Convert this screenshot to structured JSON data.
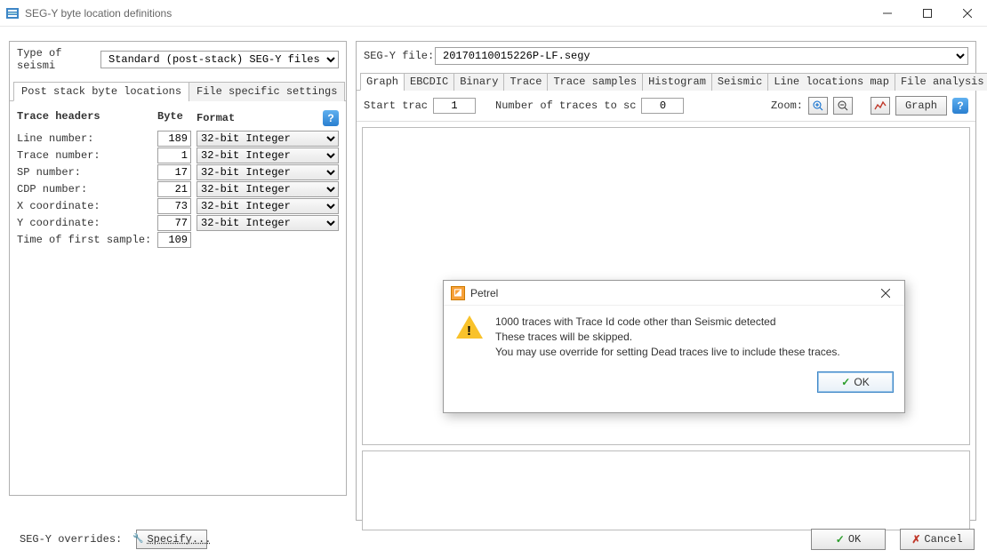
{
  "window": {
    "title": "SEG-Y byte location definitions",
    "min_tip": "Minimize",
    "max_tip": "Maximize",
    "close_tip": "Close"
  },
  "left": {
    "type_label": "Type of seismi",
    "type_value": "Standard (post-stack) SEG-Y files",
    "tabs": {
      "post_stack": "Post stack byte locations",
      "file_specific": "File specific settings"
    },
    "headers": {
      "title": "Trace headers",
      "byte": "Byte",
      "format": "Format",
      "rows": [
        {
          "name": "Line number:",
          "byte": "189",
          "format": "32-bit Integer"
        },
        {
          "name": "Trace  number:",
          "byte": "1",
          "format": "32-bit Integer"
        },
        {
          "name": "SP number:",
          "byte": "17",
          "format": "32-bit Integer"
        },
        {
          "name": "CDP number:",
          "byte": "21",
          "format": "32-bit Integer"
        },
        {
          "name": "X coordinate:",
          "byte": "73",
          "format": "32-bit Integer"
        },
        {
          "name": "Y coordinate:",
          "byte": "77",
          "format": "32-bit Integer"
        },
        {
          "name": "Time of first sample:",
          "byte": "109",
          "format": ""
        }
      ]
    }
  },
  "right": {
    "file_label": "SEG-Y file:",
    "file_value": "20170110015226P-LF.segy",
    "tabs": [
      "Graph",
      "EBCDIC",
      "Binary",
      "Trace",
      "Trace samples",
      "Histogram",
      "Seismic",
      "Line locations map",
      "File analysis"
    ],
    "toolbar": {
      "start_trace": "Start trac",
      "start_trace_val": "1",
      "num_traces": "Number of traces to sc",
      "num_traces_val": "0",
      "zoom": "Zoom:",
      "graph_btn": "Graph"
    }
  },
  "footer": {
    "overrides": "SEG-Y overrides:",
    "specify": "Specify...",
    "ok": "OK",
    "cancel": "Cancel"
  },
  "modal": {
    "title": "Petrel",
    "line1": "1000 traces with Trace Id code other than Seismic detected",
    "line2": "These traces will be skipped.",
    "line3": "You may use override for setting Dead traces live to include these traces.",
    "ok": "OK"
  }
}
